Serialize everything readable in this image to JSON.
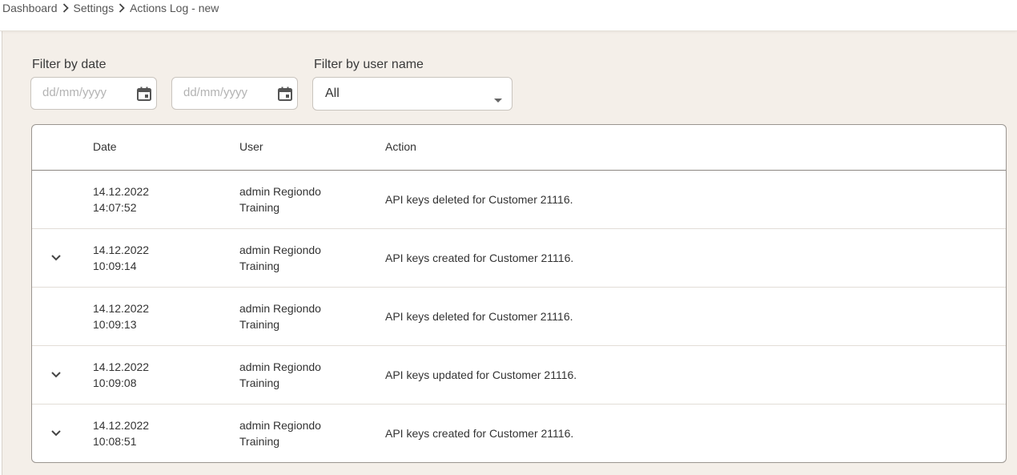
{
  "breadcrumb": {
    "items": [
      "Dashboard",
      "Settings",
      "Actions Log - new"
    ]
  },
  "filters": {
    "date_label": "Filter by date",
    "date_from_placeholder": "dd/mm/yyyy",
    "date_to_placeholder": "dd/mm/yyyy",
    "user_label": "Filter by user name",
    "user_selected": "All"
  },
  "table": {
    "headers": {
      "date": "Date",
      "user": "User",
      "action": "Action"
    },
    "rows": [
      {
        "expandable": false,
        "date": "14.12.2022",
        "time": "14:07:52",
        "user_line1": "admin Regiondo",
        "user_line2": "Training",
        "action": "API keys deleted for Customer 21116."
      },
      {
        "expandable": true,
        "date": "14.12.2022",
        "time": "10:09:14",
        "user_line1": "admin Regiondo",
        "user_line2": "Training",
        "action": "API keys created for Customer 21116."
      },
      {
        "expandable": false,
        "date": "14.12.2022",
        "time": "10:09:13",
        "user_line1": "admin Regiondo",
        "user_line2": "Training",
        "action": "API keys deleted for Customer 21116."
      },
      {
        "expandable": true,
        "date": "14.12.2022",
        "time": "10:09:08",
        "user_line1": "admin Regiondo",
        "user_line2": "Training",
        "action": "API keys updated for Customer 21116."
      },
      {
        "expandable": true,
        "date": "14.12.2022",
        "time": "10:08:51",
        "user_line1": "admin Regiondo",
        "user_line2": "Training",
        "action": "API keys created for Customer 21116."
      }
    ]
  },
  "icons": {
    "breadcrumb_separator": "chevron-right-icon",
    "date_picker": "calendar-icon",
    "select_caret": "caret-down-icon",
    "row_expand": "chevron-down-icon"
  },
  "colors": {
    "content_background": "#f4efe9",
    "card_background": "#ffffff",
    "text": "#333333",
    "placeholder": "#b3b3b3",
    "border": "#c9c4be"
  }
}
